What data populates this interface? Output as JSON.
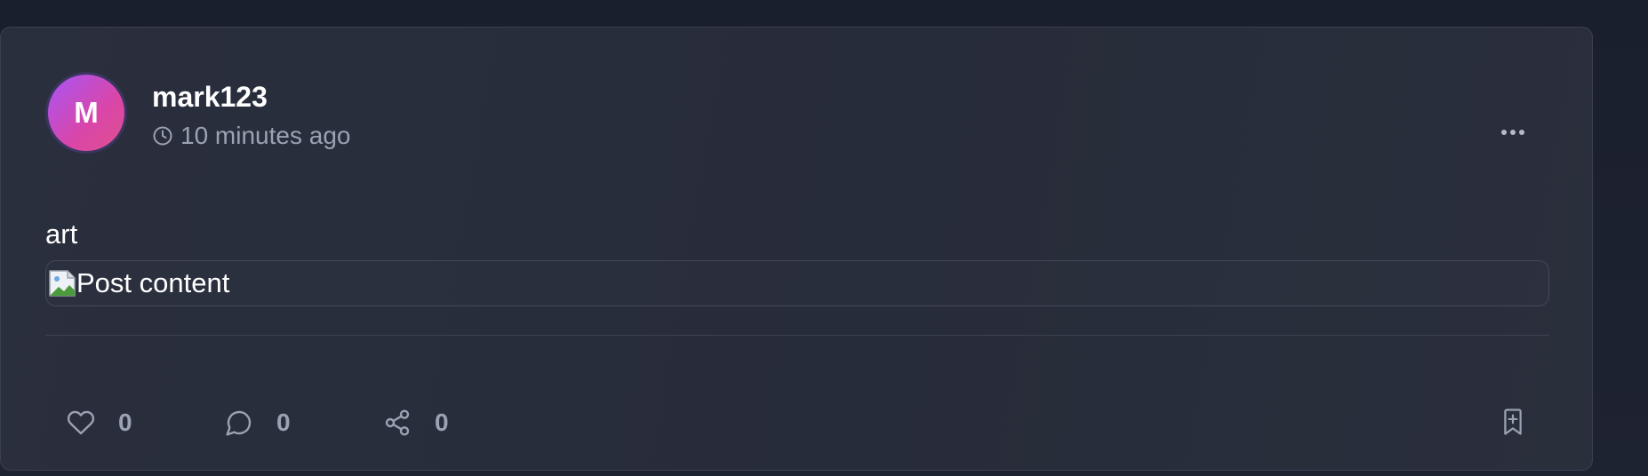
{
  "post": {
    "author": {
      "initial": "M",
      "username": "mark123"
    },
    "timestamp": "10 minutes ago",
    "caption": "art",
    "media": {
      "alt": "Post content"
    },
    "stats": {
      "likes": "0",
      "comments": "0",
      "shares": "0"
    }
  },
  "icons": {
    "time": "clock-icon",
    "menu": "more-horizontal-icon",
    "like": "heart-icon",
    "comment": "comment-icon",
    "share": "share-icon",
    "save": "bookmark-plus-icon",
    "media": "broken-image-icon"
  },
  "colors": {
    "background": "#1c2130",
    "card": "#2a2f3d",
    "text_primary": "#ffffff",
    "text_muted": "#9aa2b3",
    "avatar_gradient_start": "#a855f7",
    "avatar_gradient_end": "#e0508f"
  }
}
